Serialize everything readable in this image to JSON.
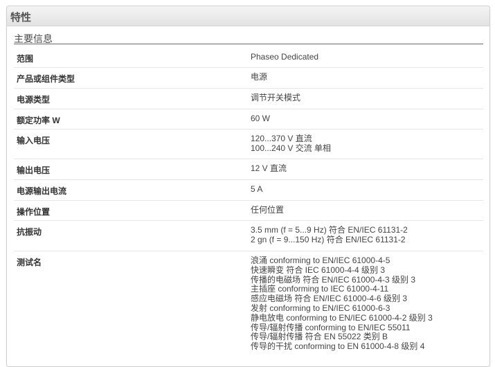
{
  "panel": {
    "title": "特性"
  },
  "section": {
    "title": "主要信息"
  },
  "rows": [
    {
      "label": "范围",
      "values": [
        "Phaseo Dedicated"
      ]
    },
    {
      "label": "产品或组件类型",
      "values": [
        "电源"
      ]
    },
    {
      "label": "电源类型",
      "values": [
        "调节开关模式"
      ]
    },
    {
      "label": "额定功率 W",
      "values": [
        "60 W"
      ]
    },
    {
      "label": "输入电压",
      "values": [
        "120...370 V 直流",
        "100...240 V 交流 单相"
      ]
    },
    {
      "label": "输出电压",
      "values": [
        "12 V 直流"
      ]
    },
    {
      "label": "电源输出电流",
      "values": [
        "5 A"
      ]
    },
    {
      "label": "操作位置",
      "values": [
        "任何位置"
      ]
    },
    {
      "label": "抗振动",
      "values": [
        "3.5 mm (f = 5...9 Hz) 符合 EN/IEC 61131-2",
        "2 gn (f = 9...150 Hz) 符合 EN/IEC 61131-2"
      ]
    },
    {
      "label": "测试名",
      "values": [
        "浪涌 conforming to EN/IEC 61000-4-5",
        "快速瞬变 符合 IEC 61000-4-4 级别 3",
        "传播的电磁场 符合 EN/IEC 61000-4-3 级别 3",
        "主插座 conforming to IEC 61000-4-11",
        "感应电磁场 符合 EN/IEC 61000-4-6 级别 3",
        "发射 conforming to EN/IEC 61000-6-3",
        "静电放电 conforming to EN/IEC 61000-4-2 级别 3",
        "传导/辐射传播 conforming to EN/IEC 55011",
        "传导/辐射传播 符合 EN 55022 类别 B",
        "传导的干扰 conforming to EN 61000-4-8 级别 4"
      ]
    }
  ]
}
